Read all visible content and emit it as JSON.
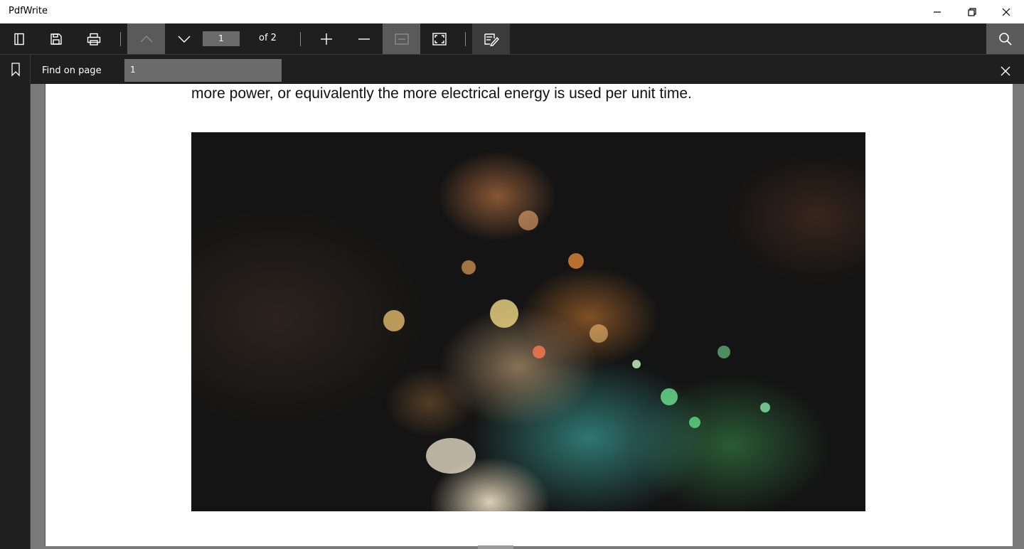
{
  "app": {
    "title": "PdfWrite"
  },
  "window_controls": {
    "minimize": "minimize-icon",
    "restore": "restore-icon",
    "close": "close-icon"
  },
  "toolbar": {
    "page_current": "1",
    "page_total": "of 2",
    "icons": [
      "sidebar-toggle-icon",
      "save-icon",
      "print-icon",
      "previous-page-icon",
      "next-page-icon",
      "zoom-in-icon",
      "zoom-out-icon",
      "fit-width-icon",
      "fit-page-icon",
      "annotate-icon",
      "search-icon"
    ]
  },
  "find_bar": {
    "label": "Find on page",
    "value": "1"
  },
  "document": {
    "text_line": "more power, or equivalently the more electrical energy is used per unit time.",
    "image": "dancer-with-glowing-particles"
  }
}
